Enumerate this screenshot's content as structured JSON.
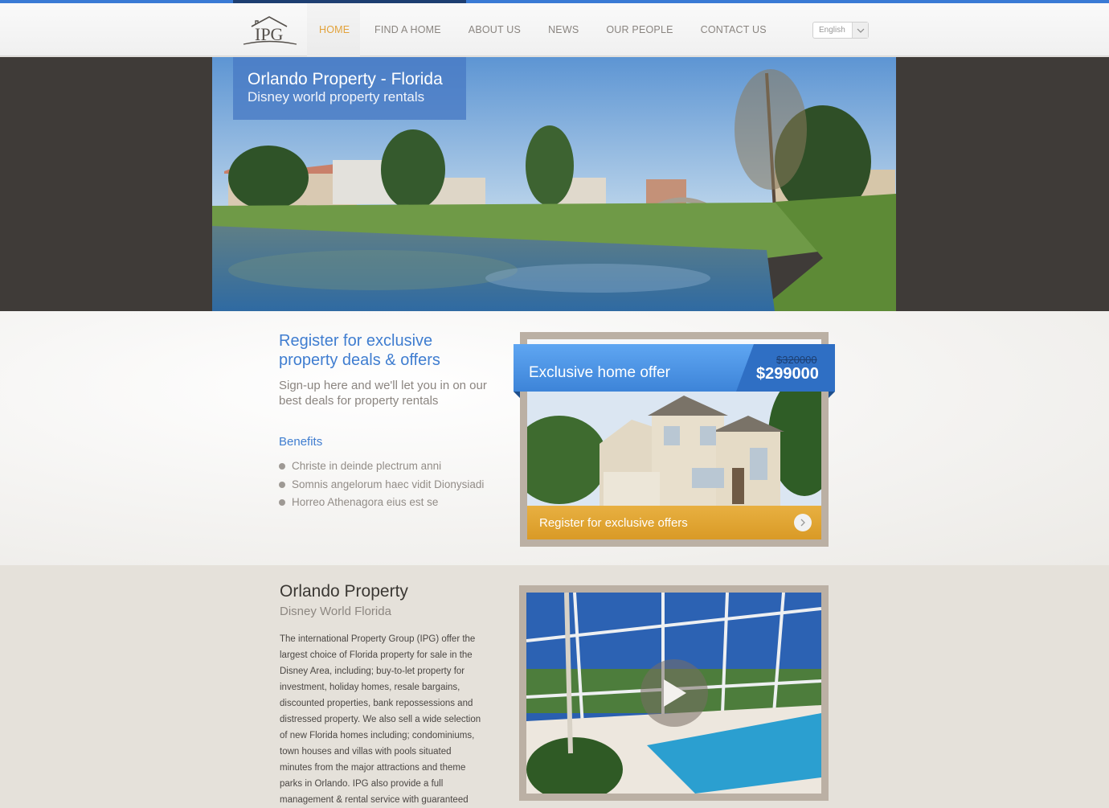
{
  "header": {
    "logo_text": "IPG",
    "nav": [
      {
        "label": "HOME",
        "active": true
      },
      {
        "label": "FIND A HOME"
      },
      {
        "label": "ABOUT US"
      },
      {
        "label": "NEWS"
      },
      {
        "label": "OUR PEOPLE"
      },
      {
        "label": "CONTACT US"
      }
    ],
    "language": "English",
    "language_icon": "chevron-down-icon"
  },
  "hero": {
    "title": "Orlando Property - Florida",
    "subtitle": "Disney world property rentals"
  },
  "register": {
    "title": "Register for exclusive property deals & offers",
    "subtitle": "Sign-up here and we'll let you in on our best deals for property rentals",
    "benefits_title": "Benefits",
    "benefits": [
      "Christe in deinde plectrum anni",
      "Somnis angelorum haec vidit Dionysiadi",
      "Horreo Athenagora eius est se"
    ]
  },
  "offer": {
    "label": "Exclusive home offer",
    "old_price": "$320000",
    "new_price": "$299000",
    "cta": "Register for exclusive offers",
    "cta_icon": "chevron-right-icon"
  },
  "about": {
    "title": "Orlando Property",
    "subtitle": "Disney World Florida",
    "body": "The international Property Group (IPG) offer the largest choice of Florida property for sale in the Disney Area, including; buy-to-let property for investment, holiday homes, resale bargains, discounted properties, bank repossessions and distressed property. We also sell a wide selection of new Florida homes including; condominiums, town houses and villas with pools situated minutes from the major attractions and theme parks in Orlando. IPG also provide a full management & rental service with guaranteed",
    "video_icon": "play-icon"
  },
  "colors": {
    "accent_blue": "#3f7dd0",
    "accent_orange": "#e2a23a"
  }
}
